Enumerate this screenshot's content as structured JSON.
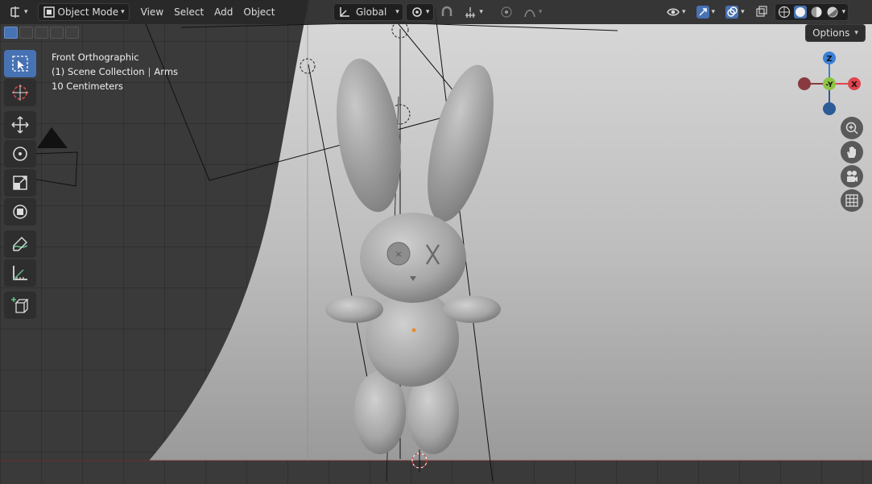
{
  "header": {
    "editor_type_icon": "viewport-icon",
    "mode_label": "Object Mode",
    "menus": [
      "View",
      "Select",
      "Add",
      "Object"
    ],
    "transform_orientation": "Global",
    "options_label": "Options"
  },
  "overlay": {
    "view_name": "Front Orthographic",
    "collection": "(1) Scene Collection",
    "active_object": "Arms",
    "grid_scale": "10 Centimeters"
  },
  "gizmo": {
    "z_label": "Z",
    "y_label": "-Y",
    "x_label": "X",
    "colors": {
      "x": "#e0444d",
      "y": "#8cc443",
      "z": "#3b7fd6",
      "neg": "#8a3a3f"
    }
  },
  "toolbar": {
    "tools": [
      "select-box",
      "cursor",
      "move",
      "rotate",
      "scale",
      "transform",
      "annotate",
      "measure",
      "add-cube"
    ]
  },
  "colors": {
    "accent": "#4772b3",
    "header_bg": "#282828",
    "viewport_bg": "#3a3a3a"
  }
}
